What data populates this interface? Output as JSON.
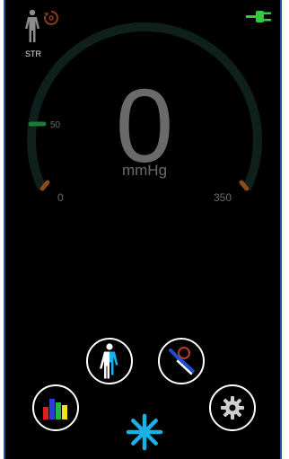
{
  "status": {
    "profile_label": "STR",
    "icons": {
      "profile": "human-body-icon",
      "cuff": "cuff-cycle-icon",
      "power": "plug-icon"
    },
    "power_color": "#2ecc40"
  },
  "gauge": {
    "value": "0",
    "unit": "mmHg",
    "min_label": "0",
    "max_label": "350",
    "mid_label": "50",
    "min": 0,
    "max": 350,
    "marker": 50,
    "arc_color": "#0e1f1c",
    "marker_color": "#1f7a3a",
    "end_tick_color": "#8a4a1a"
  },
  "controls": {
    "body_button": "human-body-icon",
    "probe_button": "probe-tool-icon",
    "chart_button": "bar-chart-icon",
    "settings_button": "gear-icon",
    "activity_button": "asterisk-icon",
    "accent_blue": "#1ab0e8"
  }
}
